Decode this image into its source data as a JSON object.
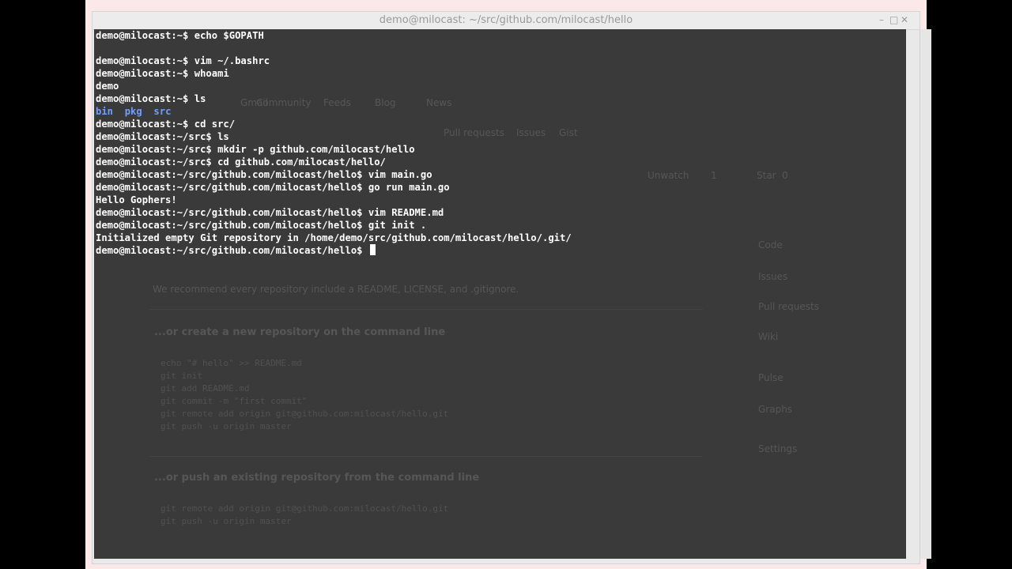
{
  "window": {
    "title": "demo@milocast: ~/src/github.com/milocast/hello",
    "controls": [
      "–",
      "□",
      "✕"
    ]
  },
  "terminal": {
    "background": "#3a3a3a",
    "text_color": "#ffffff",
    "dir_color": "#6f9fff",
    "lines": [
      "demo@milocast:~$ echo $GOPATH",
      "",
      "demo@milocast:~$ vim ~/.bashrc",
      "demo@milocast:~$ whoami",
      "demo",
      "demo@milocast:~$ ls",
      "",
      "demo@milocast:~$ cd src/",
      "demo@milocast:~/src$ ls",
      "demo@milocast:~/src$ mkdir -p github.com/milocast/hello",
      "demo@milocast:~/src$ cd github.com/milocast/hello/",
      "demo@milocast:~/src/github.com/milocast/hello$ vim main.go",
      "demo@milocast:~/src/github.com/milocast/hello$ go run main.go",
      "Hello Gophers!",
      "demo@milocast:~/src/github.com/milocast/hello$ vim README.md",
      "demo@milocast:~/src/github.com/milocast/hello$ git init .",
      "Initialized empty Git repository in /home/demo/src/github.com/milocast/hello/.git/",
      "demo@milocast:~/src/github.com/milocast/hello$ "
    ],
    "ls_output": [
      "bin",
      "pkg",
      "src"
    ]
  },
  "background_page": {
    "heading_1": "...or create a new repository on the command line",
    "heading_2": "...or push an existing repository from the command line",
    "recommend": "We recommend every repository include a README, LICENSE, and .gitignore.",
    "create_cmds": [
      "echo \"# hello\" >> README.md",
      "git init",
      "git add README.md",
      "git commit -m \"first commit\"",
      "git remote add origin git@github.com:milocast/hello.git",
      "git push -u origin master"
    ],
    "push_cmds": [
      "git remote add origin git@github.com:milocast/hello.git",
      "git push -u origin master"
    ],
    "nav": [
      "Pull requests",
      "Issues",
      "Gist"
    ],
    "repo_actions": [
      "Unwatch",
      "1",
      "Star",
      "0"
    ],
    "sidebar": [
      "Code",
      "Issues",
      "Pull requests",
      "Wiki",
      "Pulse",
      "Graphs",
      "Settings"
    ],
    "bookmarks": [
      "Gmail",
      "Community",
      "Feeds",
      "Blog",
      "News"
    ]
  }
}
